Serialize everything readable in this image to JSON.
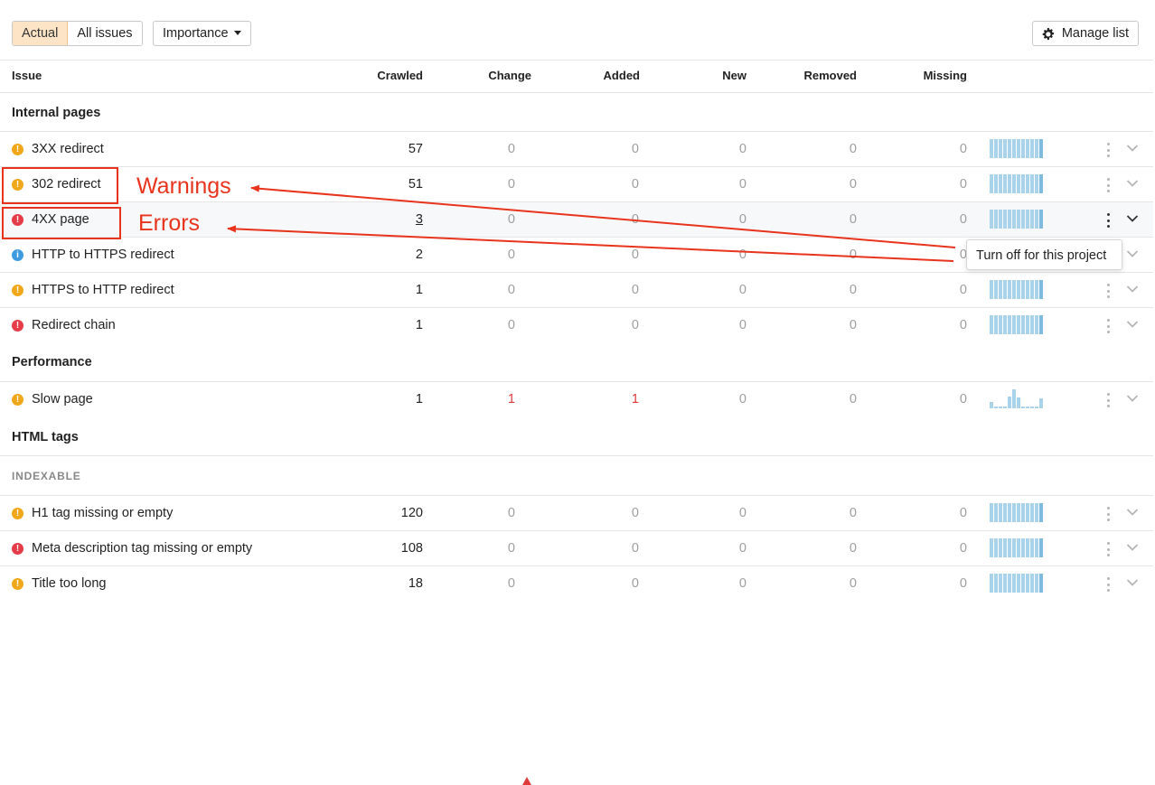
{
  "toolbar": {
    "tab_actual": "Actual",
    "tab_all_issues": "All issues",
    "importance_label": "Importance",
    "manage_label": "Manage list"
  },
  "columns": {
    "issue": "Issue",
    "crawled": "Crawled",
    "change": "Change",
    "added": "Added",
    "new": "New",
    "removed": "Removed",
    "missing": "Missing"
  },
  "sections": {
    "internal_pages": "Internal pages",
    "performance": "Performance",
    "html_tags": "HTML tags",
    "indexable": "INDEXABLE"
  },
  "rows": [
    {
      "name": "3XX redirect",
      "severity": "warning",
      "icon": "!",
      "crawled": "57",
      "change": "0",
      "added": "0",
      "new": "0",
      "removed": "0",
      "missing": "0"
    },
    {
      "name": "302 redirect",
      "severity": "warning",
      "icon": "!",
      "crawled": "51",
      "change": "0",
      "added": "0",
      "new": "0",
      "removed": "0",
      "missing": "0"
    },
    {
      "name": "4XX page",
      "severity": "error",
      "icon": "!",
      "crawled": "3",
      "change": "0",
      "added": "0",
      "new": "0",
      "removed": "0",
      "missing": "0"
    },
    {
      "name": "HTTP to HTTPS redirect",
      "severity": "notice",
      "icon": "i",
      "crawled": "2",
      "change": "0",
      "added": "0",
      "new": "0",
      "removed": "0",
      "missing": "0"
    },
    {
      "name": "HTTPS to HTTP redirect",
      "severity": "warning",
      "icon": "!",
      "crawled": "1",
      "change": "0",
      "added": "0",
      "new": "0",
      "removed": "0",
      "missing": "0"
    },
    {
      "name": "Redirect chain",
      "severity": "error",
      "icon": "!",
      "crawled": "1",
      "change": "0",
      "added": "0",
      "new": "0",
      "removed": "0",
      "missing": "0"
    },
    {
      "name": "Slow page",
      "severity": "warning",
      "icon": "!",
      "crawled": "1",
      "change": "1",
      "added": "1",
      "new": "0",
      "removed": "0",
      "missing": "0"
    },
    {
      "name": "H1 tag missing or empty",
      "severity": "warning",
      "icon": "!",
      "crawled": "120",
      "change": "0",
      "added": "0",
      "new": "0",
      "removed": "0",
      "missing": "0"
    },
    {
      "name": "Meta description tag missing or empty",
      "severity": "error",
      "icon": "!",
      "crawled": "108",
      "change": "0",
      "added": "0",
      "new": "0",
      "removed": "0",
      "missing": "0"
    },
    {
      "name": "Title too long",
      "severity": "warning",
      "icon": "!",
      "crawled": "18",
      "change": "0",
      "added": "0",
      "new": "0",
      "removed": "0",
      "missing": "0"
    }
  ],
  "annotations": {
    "warnings": "Warnings",
    "errors": "Errors"
  },
  "tooltip": {
    "text": "Turn off for this project"
  },
  "colors": {
    "warning": "#f0a81a",
    "error": "#e63b48",
    "notice": "#3d9be0",
    "annotation": "#e8341c",
    "active_tab": "#fde4c6",
    "sparkline": "#a8d3ea"
  },
  "icons": {
    "manage": "gear-icon",
    "importance": "caret-down-icon",
    "row_menu": "kebab-menu-icon",
    "row_expand": "chevron-down-icon",
    "change_up": "triangle-up-icon"
  }
}
